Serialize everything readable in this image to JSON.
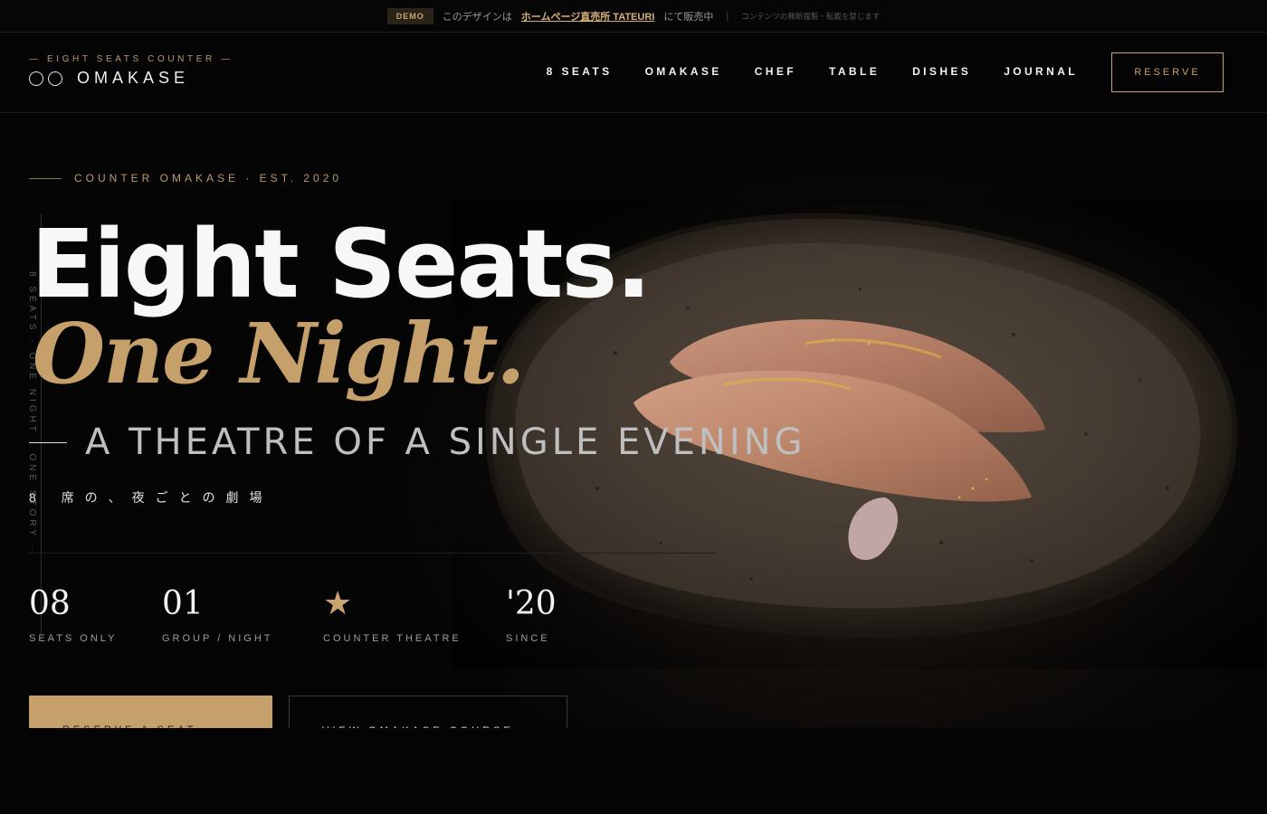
{
  "demo_bar": {
    "badge": "DEMO",
    "text_before": "このデザインは",
    "link": "ホームページ直売所 TATEURI",
    "text_after": "にて販売中",
    "separator": "|",
    "note": "コンテンツの無断複製・転載を禁じます"
  },
  "header": {
    "brand_sub": "— EIGHT SEATS COUNTER —",
    "brand_name": "OMAKASE",
    "nav": [
      "8 SEATS",
      "OMAKASE",
      "CHEF",
      "TABLE",
      "DISHES",
      "JOURNAL"
    ],
    "reserve": "RESERVE"
  },
  "hero": {
    "eyebrow": "COUNTER OMAKASE · EST. 2020",
    "vertical_text": "8 SEATS · ONE NIGHT · ONE STORY ·",
    "title_line1": "Eight Seats.",
    "title_line2": "One Night.",
    "tagline": "A THEATRE OF A SINGLE EVENING",
    "tagline_jp": "8 席の、夜ごとの劇場",
    "stats": [
      {
        "value": "08",
        "label": "SEATS ONLY"
      },
      {
        "value": "01",
        "label": "GROUP / NIGHT"
      },
      {
        "value": "★",
        "label": "COUNTER THEATRE"
      },
      {
        "value": "'20",
        "label": "SINCE"
      }
    ],
    "cta_primary": "RESERVE A SEAT →",
    "cta_secondary": "VIEW OMAKASE COURSE"
  },
  "colors": {
    "accent": "#c6a06a",
    "background": "#040404",
    "text": "#f7f7f7"
  }
}
